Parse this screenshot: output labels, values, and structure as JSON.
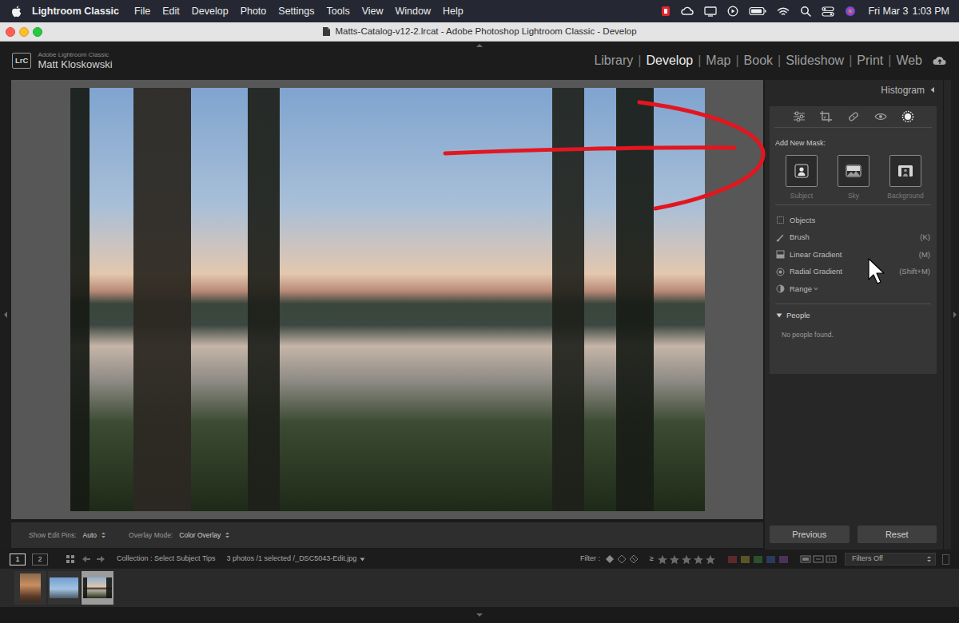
{
  "menubar": {
    "app": "Lightroom Classic",
    "items": [
      "File",
      "Edit",
      "Develop",
      "Photo",
      "Settings",
      "Tools",
      "View",
      "Window",
      "Help"
    ],
    "date": "Fri Mar 3",
    "time": "1:03 PM"
  },
  "window": {
    "title": "Matts-Catalog-v12-2.lrcat - Adobe Photoshop Lightroom Classic - Develop"
  },
  "identity": {
    "badge": "LrC",
    "product": "Adobe Lightroom Classic",
    "user": "Matt Kloskowski"
  },
  "modules": {
    "separator": "|",
    "items": [
      {
        "label": "Library",
        "selected": false
      },
      {
        "label": "Develop",
        "selected": true
      },
      {
        "label": "Map",
        "selected": false
      },
      {
        "label": "Book",
        "selected": false
      },
      {
        "label": "Slideshow",
        "selected": false
      },
      {
        "label": "Print",
        "selected": false
      },
      {
        "label": "Web",
        "selected": false
      }
    ]
  },
  "toolbar": {
    "pins_label": "Show Edit Pins:",
    "pins_value": "Auto",
    "overlay_label": "Overlay Mode:",
    "overlay_value": "Color Overlay"
  },
  "right_panel": {
    "histogram": "Histogram",
    "edit_tools": [
      {
        "kind": "sliders",
        "selected": false
      },
      {
        "kind": "crop",
        "selected": false
      },
      {
        "kind": "heal",
        "selected": false
      },
      {
        "kind": "redeye",
        "selected": false
      },
      {
        "kind": "mask",
        "selected": true
      }
    ],
    "add_new_mask": "Add New Mask:",
    "mask_types": [
      {
        "label": "Subject",
        "kind": "subject"
      },
      {
        "label": "Sky",
        "kind": "sky"
      },
      {
        "label": "Background",
        "kind": "background"
      }
    ],
    "tools": [
      {
        "label": "Objects",
        "kind": "objects",
        "has_menu": false
      },
      {
        "label": "Brush",
        "shortcut": "(K)",
        "kind": "brush",
        "has_menu": false
      },
      {
        "label": "Linear Gradient",
        "shortcut": "(M)",
        "kind": "linear",
        "has_menu": false
      },
      {
        "label": "Radial Gradient",
        "shortcut": "(Shift+M)",
        "kind": "radial",
        "has_menu": false
      },
      {
        "label": "Range",
        "kind": "range",
        "has_menu": true
      }
    ],
    "people": {
      "title": "People",
      "expanded": true,
      "message": "No people found."
    },
    "buttons": [
      "Previous",
      "Reset"
    ]
  },
  "filmstrip": {
    "views": [
      {
        "label": "1",
        "selected": true
      },
      {
        "label": "2",
        "selected": false
      }
    ],
    "collection": "Collection : Select Subject Tips",
    "selection": "3 photos /1 selected /_DSC5043-Edit.jpg",
    "filter_label": "Filter :",
    "rating_operator": "≥",
    "stars": 0,
    "color_labels": [
      {
        "color": "#5c2a2a"
      },
      {
        "color": "#5a5428"
      },
      {
        "color": "#2c4f2c"
      },
      {
        "color": "#2a3a5c"
      },
      {
        "color": "#4a325a"
      }
    ],
    "filters": "Filters Off",
    "thumbnails": [
      {
        "kind": "portrait",
        "selected": false
      },
      {
        "kind": "landscape",
        "selected": false
      },
      {
        "kind": "landscape",
        "selected": true
      }
    ]
  }
}
